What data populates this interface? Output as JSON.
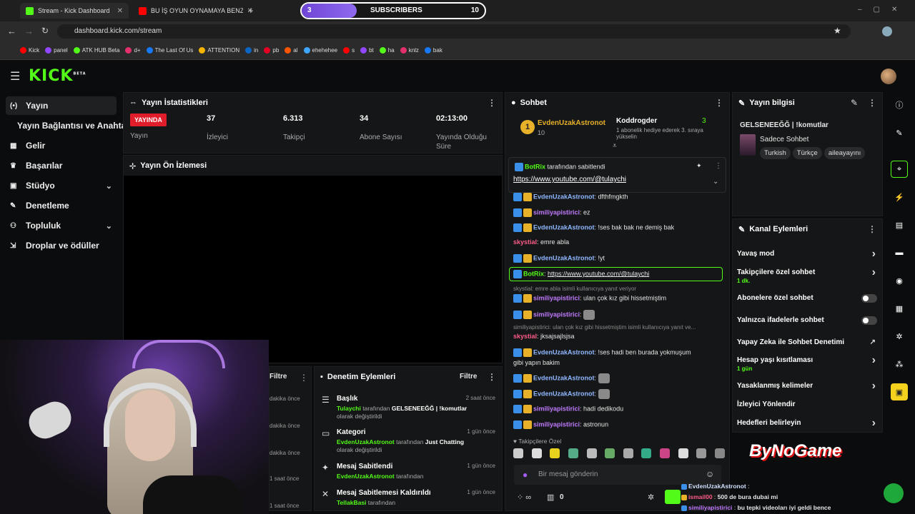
{
  "browser": {
    "tabs": [
      {
        "label": "Stream - Kick Dashboard",
        "active": true
      },
      {
        "label": "BU İŞ OYUN OYNAMAYA BENZE",
        "active": false
      }
    ],
    "subscribers": {
      "count_left": "3",
      "label": "SUBSCRIBERS",
      "count_right": "10",
      "progress": 0.3
    },
    "url": "dashboard.kick.com/stream",
    "bookmarks": [
      "Kick",
      "panel",
      "ATK HUB Beta",
      "d+",
      "The Last Of Us",
      "ATTENTION",
      "in",
      "pb",
      "al",
      "ehehehee",
      "s",
      "bt",
      "ha",
      "knlz",
      "bak"
    ]
  },
  "header": {
    "logo": "KICK",
    "logo_sup": "BETA"
  },
  "sidebar": {
    "items": [
      {
        "label": "Yayın",
        "icon": "broadcast-icon"
      },
      {
        "label": "Yayın Bağlantısı ve Anahtarı",
        "icon": ""
      },
      {
        "label": "Gelir",
        "icon": "revenue-icon"
      },
      {
        "label": "Başarılar",
        "icon": "trophy-icon"
      },
      {
        "label": "Stüdyo",
        "icon": "studio-icon"
      },
      {
        "label": "Denetleme",
        "icon": "wrench-icon"
      },
      {
        "label": "Topluluk",
        "icon": "community-icon"
      },
      {
        "label": "Droplar ve ödüller",
        "icon": "drops-icon"
      }
    ]
  },
  "stats": {
    "title": "Yayın İstatistikleri",
    "live_label": "YAYINDA",
    "stream_label": "Yayın",
    "items": [
      {
        "value": "37",
        "label": "İzleyici"
      },
      {
        "value": "6.313",
        "label": "Takipçi"
      },
      {
        "value": "34",
        "label": "Abone Sayısı"
      },
      {
        "value": "02:13:00",
        "label": "Yayında Olduğu Süre"
      }
    ]
  },
  "preview": {
    "title": "Yayın Ön İzlemesi"
  },
  "left_partial": {
    "filter": "Filtre",
    "times": [
      "dakika önce",
      "dakika önce",
      "dakika önce",
      "1 saat önce",
      "1 saat önce"
    ]
  },
  "mod_actions": {
    "title": "Denetim Eylemleri",
    "filter": "Filtre",
    "items": [
      {
        "title": "Başlık",
        "time": "2 saat önce",
        "actor": "Tulaychi",
        "mid": "tarafından",
        "target": "GELSENEEĞĞ | !komutlar",
        "tail": "olarak değiştirildi"
      },
      {
        "title": "Kategori",
        "time": "1 gün önce",
        "actor": "EvdenUzakAstronot",
        "mid": "tarafından",
        "target": "Just Chatting",
        "tail": "olarak değiştirildi"
      },
      {
        "title": "Mesaj Sabitlendi",
        "time": "1 gün önce",
        "actor": "EvdenUzakAstronot",
        "mid": "tarafından",
        "target": "",
        "tail": ""
      },
      {
        "title": "Mesaj Sabitlemesi Kaldırıldı",
        "time": "1 gün önce",
        "actor": "TellakBasi",
        "mid": "tarafından",
        "target": "",
        "tail": ""
      }
    ]
  },
  "chat": {
    "title": "Sohbet",
    "top_gifter": {
      "name": "EvdenUzakAstronot",
      "count": "10",
      "rank": "1"
    },
    "gift_user": {
      "name": "Koddrogder",
      "text": "1 abonelik hediye ederek 3. sıraya yükselin",
      "count": "3"
    },
    "pinned": {
      "by": "BotRix",
      "by_text": "tarafından sabitlendi",
      "link": "https://www.youtube.com/@tulaychi"
    },
    "messages": [
      {
        "user": "EvdenUzakAstronot",
        "text": "dfthfmgkth",
        "color": "#8fb8ff"
      },
      {
        "user": "similiyapistirici",
        "text": "ez",
        "color": "#c07bff"
      },
      {
        "user": "EvdenUzakAstronot",
        "text": "!ses bak bak ne demiş bak",
        "color": "#8fb8ff"
      },
      {
        "user": "skystial",
        "text": "emre abla",
        "color": "#ff5c8a"
      },
      {
        "user": "EvdenUzakAstronot",
        "text": "!yt",
        "color": "#8fb8ff"
      },
      {
        "user": "BotRix",
        "text": "https://www.youtube.com/@tulaychi",
        "color": "#53fc18"
      },
      {
        "user": "similiyapistirici",
        "text": "ulan çok kız gibi hissetmiştim",
        "color": "#c07bff"
      },
      {
        "user": "similiyapistirici",
        "text": "",
        "color": "#c07bff"
      },
      {
        "user": "skystial",
        "text": "jksajsajlsjsa",
        "color": "#ff5c8a"
      },
      {
        "user": "EvdenUzakAstronot",
        "text": "!ses hadi ben burada yokmuşum",
        "color": "#8fb8ff"
      },
      {
        "user": "",
        "text": "gibi yapın bakim",
        "color": "#8fb8ff"
      },
      {
        "user": "EvdenUzakAstronot",
        "text": "",
        "color": "#8fb8ff"
      },
      {
        "user": "EvdenUzakAstronot",
        "text": "",
        "color": "#8fb8ff"
      },
      {
        "user": "similiyapistirici",
        "text": "hadi dedikodu",
        "color": "#c07bff"
      },
      {
        "user": "similiyapistirici",
        "text": "astronun",
        "color": "#c07bff"
      }
    ],
    "reply1": "skystial: emre abla isimli kullanıcıya yanıt veriyor",
    "reply2": "similiyapistirici: ulan çok kız gibi hissetmiştim isimli kullanıcıya yanıt ve...",
    "emote_bar_label": "Takipçilere Özel",
    "input_placeholder": "Bir mesaj gönderin",
    "footer_count": "0"
  },
  "stream_info": {
    "title": "Yayın bilgisi",
    "stream_title": "GELSENEEĞĞ | !komutlar",
    "category": "Sadece Sohbet",
    "tags": [
      "Turkish",
      "Türkçe",
      "aileayayını"
    ]
  },
  "channel_actions": {
    "title": "Kanal Eylemleri",
    "items": [
      {
        "label": "Yavaş mod",
        "sub": "",
        "control": "arrow"
      },
      {
        "label": "Takipçilere özel sohbet",
        "sub": "1 dk.",
        "control": "arrow"
      },
      {
        "label": "Abonelere özel sohbet",
        "sub": "",
        "control": "toggle"
      },
      {
        "label": "Yalnızca ifadelerle sohbet",
        "sub": "",
        "control": "toggle"
      },
      {
        "label": "Yapay Zeka ile Sohbet Denetimi",
        "sub": "",
        "control": "external"
      },
      {
        "label": "Hesap yaşı kısıtlaması",
        "sub": "1 gün",
        "control": "arrow"
      },
      {
        "label": "Yasaklanmış kelimeler",
        "sub": "",
        "control": "arrow"
      },
      {
        "label": "İzleyici Yönlendir",
        "sub": "",
        "control": "none"
      },
      {
        "label": "Hedefleri belirleyin",
        "sub": "",
        "control": "arrow"
      }
    ]
  },
  "overlay": {
    "brand": "ByNoGame",
    "chat": [
      {
        "user": "EvdenUzakAstronot",
        "text": ""
      },
      {
        "user": "ismail00",
        "text": "500 de bura dubai mi"
      },
      {
        "user": "similiyapistirici",
        "text": "bu tepki videoları iyi geldi bence"
      }
    ]
  }
}
